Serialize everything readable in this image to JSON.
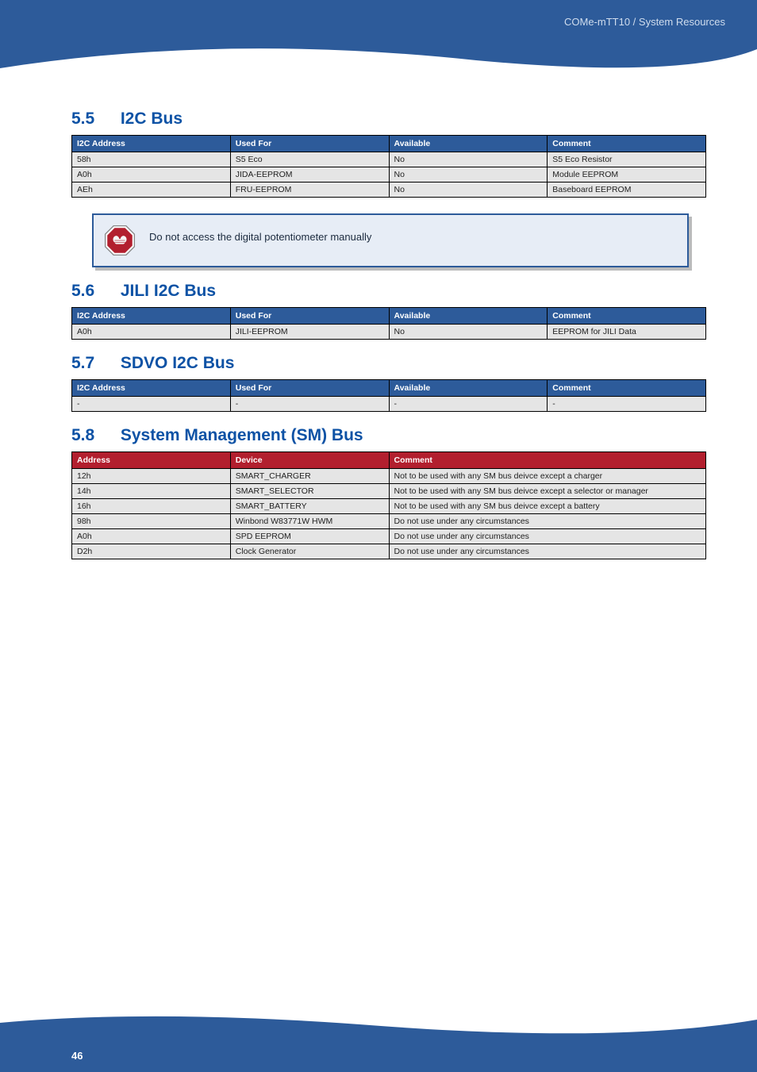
{
  "header": {
    "breadcrumb": "COMe-mTT10 / System Resources"
  },
  "section_5_5": {
    "number": "5.5",
    "title": "I2C Bus",
    "table": {
      "headers": [
        "I2C Address",
        "Used For",
        "Available",
        "Comment"
      ],
      "rows": [
        [
          "58h",
          "S5 Eco",
          "No",
          "S5 Eco Resistor"
        ],
        [
          "A0h",
          "JIDA-EEPROM",
          "No",
          "Module EEPROM"
        ],
        [
          "AEh",
          "FRU-EEPROM",
          "No",
          "Baseboard EEPROM"
        ]
      ]
    },
    "note": "Do not access the digital potentiometer manually"
  },
  "section_5_6": {
    "number": "5.6",
    "title": "JILI I2C Bus",
    "table": {
      "headers": [
        "I2C Address",
        "Used For",
        "Available",
        "Comment"
      ],
      "rows": [
        [
          "A0h",
          "JILI-EEPROM",
          "No",
          "EEPROM for JILI Data"
        ]
      ]
    }
  },
  "section_5_7": {
    "number": "5.7",
    "title": "SDVO I2C Bus",
    "table": {
      "headers": [
        "I2C Address",
        "Used For",
        "Available",
        "Comment"
      ],
      "rows": [
        [
          "-",
          "-",
          "-",
          "-"
        ]
      ]
    }
  },
  "section_5_8": {
    "number": "5.8",
    "title": "System Management (SM) Bus",
    "table": {
      "headers": [
        "Address",
        "Device",
        "Comment"
      ],
      "rows": [
        [
          "12h",
          "SMART_CHARGER",
          "Not to be used with any SM bus deivce except a charger"
        ],
        [
          "14h",
          "SMART_SELECTOR",
          "Not to be used with any SM bus deivce except a selector or manager"
        ],
        [
          "16h",
          "SMART_BATTERY",
          "Not to be used with any SM bus deivce except a battery"
        ],
        [
          "98h",
          "Winbond W83771W HWM",
          "Do not use under any circumstances"
        ],
        [
          "A0h",
          "SPD EEPROM",
          "Do not use under any circumstances"
        ],
        [
          "D2h",
          "Clock Generator",
          "Do not use under any circumstances"
        ]
      ]
    }
  },
  "footer": {
    "page_number": "46"
  }
}
